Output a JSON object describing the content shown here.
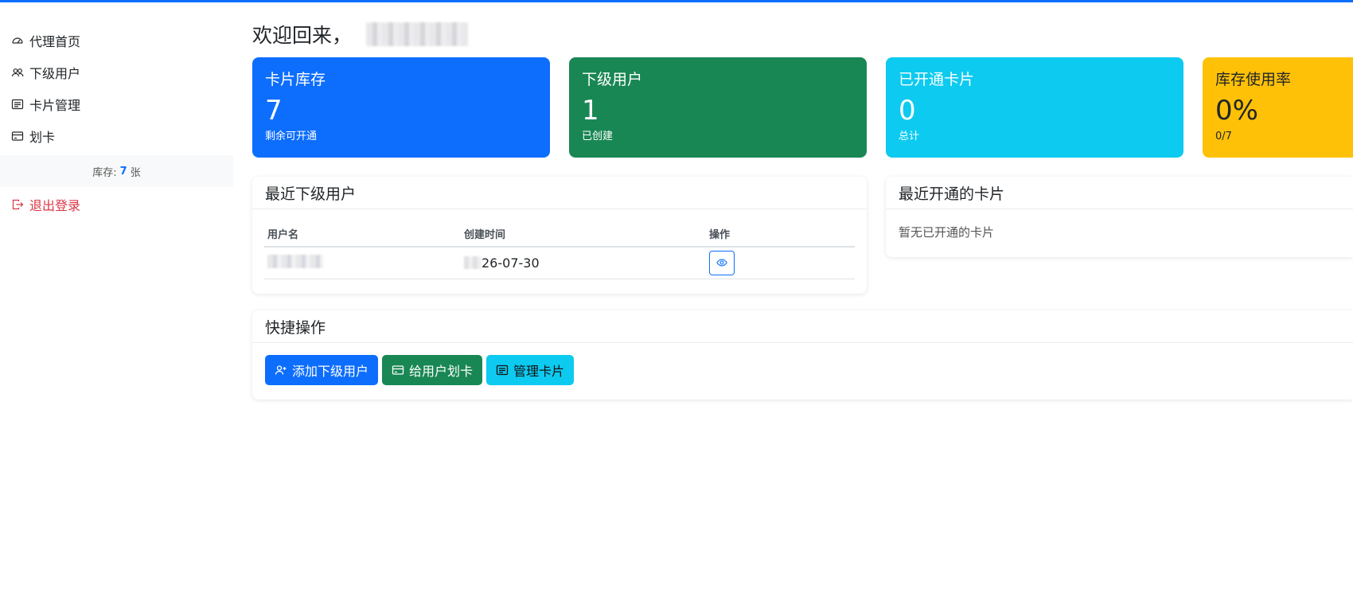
{
  "sidebar": {
    "items": [
      {
        "label": "代理首页",
        "icon": "speedometer-icon"
      },
      {
        "label": "下级用户",
        "icon": "people-icon"
      },
      {
        "label": "卡片管理",
        "icon": "card-list-icon"
      },
      {
        "label": "划卡",
        "icon": "credit-card-icon"
      }
    ],
    "stock_prefix": "库存:",
    "stock_value": "7",
    "stock_unit": "张",
    "logout": "退出登录"
  },
  "main": {
    "welcome": "欢迎回来，",
    "stats": [
      {
        "title": "卡片库存",
        "value": "7",
        "sub": "剩余可开通",
        "color": "#0d6efd"
      },
      {
        "title": "下级用户",
        "value": "1",
        "sub": "已创建",
        "color": "#198754"
      },
      {
        "title": "已开通卡片",
        "value": "0",
        "sub": "总计",
        "color": "#0dcaf0"
      },
      {
        "title": "库存使用率",
        "value": "0%",
        "sub": "0/7",
        "color": "#ffc107"
      }
    ],
    "recent_users": {
      "title": "最近下级用户",
      "headers": [
        "用户名",
        "创建时间",
        "操作"
      ],
      "rows": [
        {
          "created": "26-07-30"
        }
      ]
    },
    "recent_cards": {
      "title": "最近开通的卡片",
      "empty": "暂无已开通的卡片"
    },
    "quick": {
      "title": "快捷操作",
      "buttons": [
        {
          "label": "添加下级用户",
          "icon": "person-plus-icon"
        },
        {
          "label": "给用户划卡",
          "icon": "credit-card-icon"
        },
        {
          "label": "管理卡片",
          "icon": "card-list-icon"
        }
      ]
    }
  }
}
